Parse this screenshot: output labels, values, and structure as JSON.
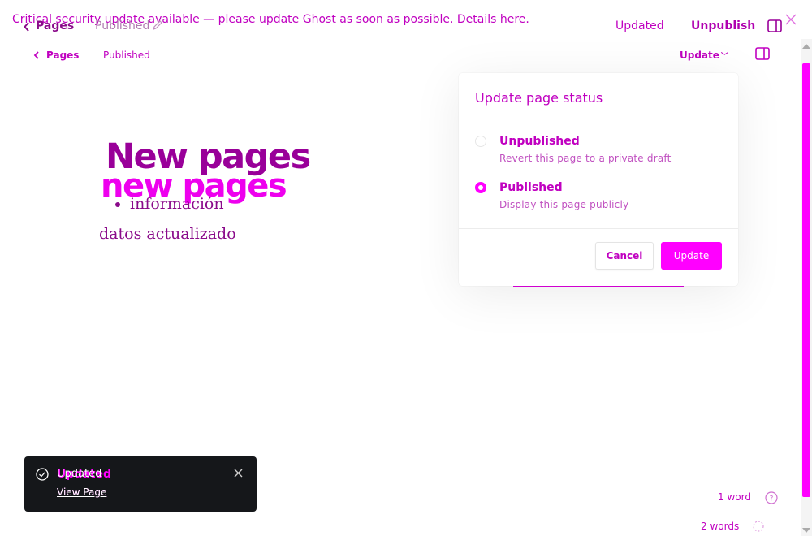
{
  "banner": {
    "text": "Critical security update available — please update Ghost as soon as possible.",
    "link": "Details here."
  },
  "ghost_header": {
    "crumb": "Pages",
    "status": "Published",
    "updated": "Updated",
    "unpublish": "Unpublish"
  },
  "header": {
    "back_label": "Pages",
    "status": "Published",
    "update_label": "Update"
  },
  "content": {
    "title": "New pages",
    "title_ghost": "new pages",
    "list_item": "información",
    "line_word1": "datos",
    "line_word2": "actualizado"
  },
  "popover": {
    "title": "Update page status",
    "options": [
      {
        "label": "Unpublished",
        "description": "Revert this page to a private draft",
        "selected": false
      },
      {
        "label": "Published",
        "description": "Display this page publicly",
        "selected": true
      }
    ],
    "cancel_label": "Cancel",
    "update_label": "Update"
  },
  "word_count": {
    "primary": "1 word",
    "ghost": "2 words"
  },
  "toast": {
    "title": "Updated",
    "title_ghost": "Updated",
    "link": "View Page",
    "link_ghost": "View Page"
  },
  "colors": {
    "accent": "#ff00ff",
    "text": "#c000c0",
    "toast_bg": "#15171a"
  }
}
